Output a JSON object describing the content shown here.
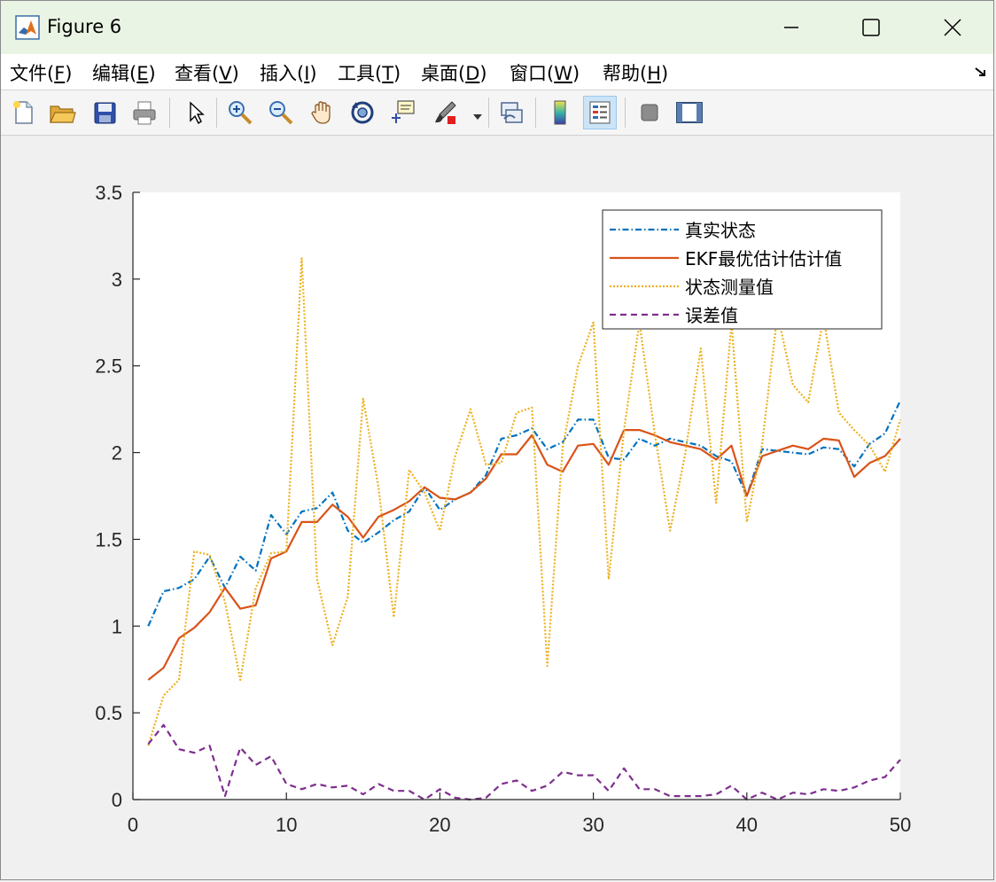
{
  "window": {
    "title": "Figure 6"
  },
  "menu": [
    {
      "label": "文件(",
      "key": "F",
      "tail": ")"
    },
    {
      "label": "编辑(",
      "key": "E",
      "tail": ")"
    },
    {
      "label": "查看(",
      "key": "V",
      "tail": ")"
    },
    {
      "label": "插入(",
      "key": "I",
      "tail": ")"
    },
    {
      "label": "工具(",
      "key": "T",
      "tail": ")"
    },
    {
      "label": "桌面(",
      "key": "D",
      "tail": ")"
    },
    {
      "label": "窗口(",
      "key": "W",
      "tail": ")"
    },
    {
      "label": "帮助(",
      "key": "H",
      "tail": ")"
    }
  ],
  "toolbar_icons": [
    "new-figure-icon",
    "open-file-icon",
    "save-icon",
    "print-icon",
    "select-arrow-icon",
    "zoom-in-icon",
    "zoom-out-icon",
    "pan-hand-icon",
    "rotate-3d-icon",
    "data-cursor-icon",
    "brush-icon",
    "link-plot-icon",
    "colorbar-icon",
    "legend-icon",
    "hide-plot-tools-icon",
    "show-plot-tools-icon"
  ],
  "chart_data": {
    "type": "line",
    "title": "",
    "xlabel": "",
    "ylabel": "",
    "xlim": [
      0,
      50
    ],
    "ylim": [
      0,
      3.5
    ],
    "xticks": [
      "0",
      "10",
      "20",
      "30",
      "40",
      "50"
    ],
    "yticks": [
      "0",
      "0.5",
      "1",
      "1.5",
      "2",
      "2.5",
      "3",
      "3.5"
    ],
    "grid": false,
    "legend_position": "top-right",
    "x": [
      1,
      2,
      3,
      4,
      5,
      6,
      7,
      8,
      9,
      10,
      11,
      12,
      13,
      14,
      15,
      16,
      17,
      18,
      19,
      20,
      21,
      22,
      23,
      24,
      25,
      26,
      27,
      28,
      29,
      30,
      31,
      32,
      33,
      34,
      35,
      36,
      37,
      38,
      39,
      40,
      41,
      42,
      43,
      44,
      45,
      46,
      47,
      48,
      49,
      50
    ],
    "series": [
      {
        "name": "真实状态",
        "color": "#0072bd",
        "style": "dashdot",
        "values": [
          1.0,
          1.2,
          1.22,
          1.27,
          1.4,
          1.22,
          1.4,
          1.32,
          1.64,
          1.53,
          1.66,
          1.68,
          1.77,
          1.55,
          1.48,
          1.54,
          1.61,
          1.66,
          1.8,
          1.67,
          1.73,
          1.77,
          1.87,
          2.08,
          2.1,
          2.14,
          2.02,
          2.06,
          2.19,
          2.19,
          1.97,
          1.96,
          2.08,
          2.04,
          2.08,
          2.06,
          2.04,
          1.98,
          1.95,
          1.75,
          2.02,
          2.01,
          2.0,
          1.99,
          2.03,
          2.02,
          1.92,
          2.05,
          2.11,
          2.3
        ]
      },
      {
        "name": "EKF最优估计估计值",
        "color": "#d95319",
        "style": "solid",
        "values": [
          0.69,
          0.76,
          0.93,
          0.99,
          1.08,
          1.22,
          1.1,
          1.12,
          1.39,
          1.43,
          1.6,
          1.6,
          1.7,
          1.63,
          1.51,
          1.63,
          1.67,
          1.72,
          1.8,
          1.74,
          1.73,
          1.77,
          1.85,
          1.99,
          1.99,
          2.1,
          1.93,
          1.89,
          2.04,
          2.05,
          1.93,
          2.13,
          2.13,
          2.1,
          2.06,
          2.04,
          2.02,
          1.96,
          2.04,
          1.75,
          1.98,
          2.01,
          2.04,
          2.02,
          2.08,
          2.07,
          1.86,
          1.94,
          1.98,
          2.08
        ]
      },
      {
        "name": "状态测量值",
        "color": "#edb120",
        "style": "dotted",
        "values": [
          0.31,
          0.6,
          0.69,
          1.43,
          1.41,
          1.14,
          0.69,
          1.22,
          1.42,
          1.43,
          3.12,
          1.27,
          0.89,
          1.17,
          2.31,
          1.8,
          1.05,
          1.9,
          1.77,
          1.55,
          1.98,
          2.25,
          1.93,
          1.94,
          2.23,
          2.26,
          0.77,
          2.03,
          2.5,
          2.75,
          1.27,
          2.13,
          2.75,
          2.11,
          1.55,
          2.0,
          2.6,
          1.71,
          2.75,
          1.6,
          2.05,
          2.8,
          2.39,
          2.29,
          2.78,
          2.23,
          2.13,
          2.04,
          1.89,
          2.19
        ]
      },
      {
        "name": "误差值",
        "color": "#7e2f8e",
        "style": "dashed",
        "values": [
          0.32,
          0.43,
          0.29,
          0.27,
          0.31,
          0.02,
          0.3,
          0.2,
          0.25,
          0.09,
          0.06,
          0.09,
          0.07,
          0.08,
          0.03,
          0.09,
          0.05,
          0.05,
          0.0,
          0.06,
          0.01,
          0.0,
          0.01,
          0.09,
          0.11,
          0.05,
          0.08,
          0.16,
          0.14,
          0.14,
          0.05,
          0.18,
          0.06,
          0.06,
          0.02,
          0.02,
          0.02,
          0.03,
          0.08,
          0.0,
          0.04,
          0.0,
          0.04,
          0.03,
          0.06,
          0.05,
          0.07,
          0.11,
          0.13,
          0.23
        ]
      }
    ]
  }
}
